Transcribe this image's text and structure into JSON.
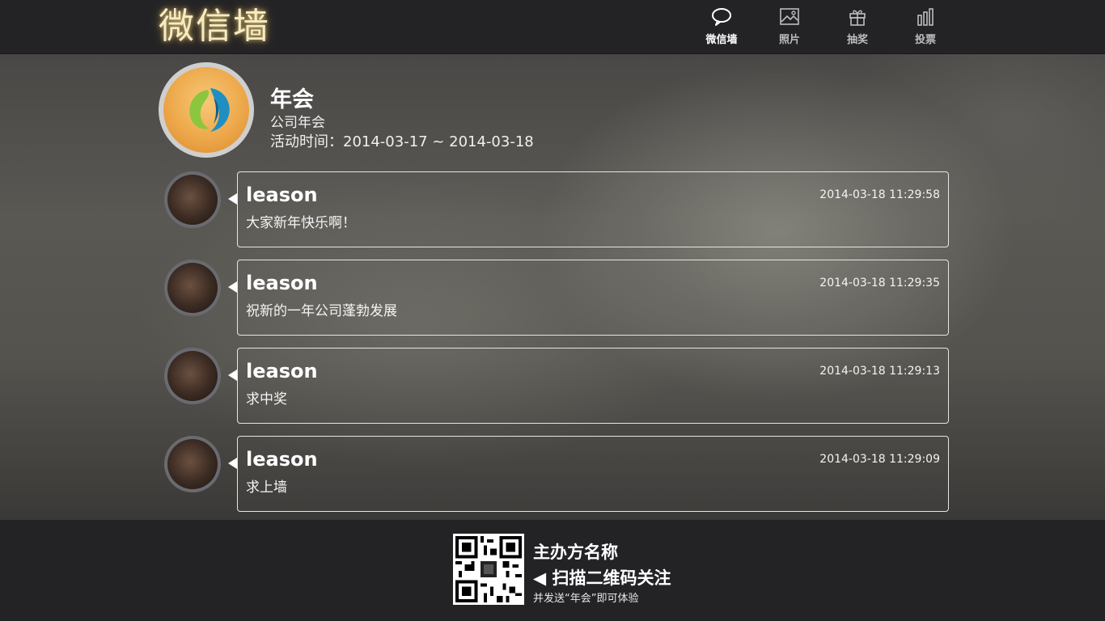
{
  "header": {
    "logo": "微信墙",
    "nav": [
      {
        "label": "微信墙",
        "icon": "chat-bubble-icon",
        "active": true
      },
      {
        "label": "照片",
        "icon": "photo-icon",
        "active": false
      },
      {
        "label": "抽奖",
        "icon": "gift-icon",
        "active": false
      },
      {
        "label": "投票",
        "icon": "bar-chart-icon",
        "active": false
      }
    ]
  },
  "event": {
    "title": "年会",
    "subtitle": "公司年会",
    "time": "活动时间：2014-03-17 ~ 2014-03-18"
  },
  "messages": [
    {
      "name": "leason",
      "time": "2014-03-18 11:29:58",
      "text": "大家新年快乐啊！"
    },
    {
      "name": "leason",
      "time": "2014-03-18 11:29:35",
      "text": "祝新的一年公司蓬勃发展"
    },
    {
      "name": "leason",
      "time": "2014-03-18 11:29:13",
      "text": "求中奖"
    },
    {
      "name": "leason",
      "time": "2014-03-18 11:29:09",
      "text": "求上墙"
    }
  ],
  "footer": {
    "sponsor": "主办方名称",
    "scan": "◀ 扫描二维码关注",
    "send": "并发送“年会”即可体验"
  },
  "colors": {
    "header_bg": "#232326",
    "logo_glow": "#f6ecc4",
    "bubble_border": "#e6e6e6"
  }
}
